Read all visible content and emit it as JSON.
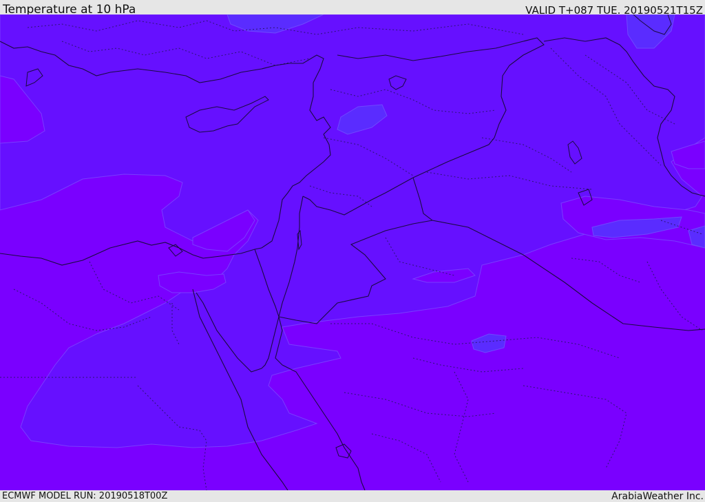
{
  "header": {
    "title": "Temperature at 10 hPa",
    "valid_time": "VALID T+087 TUE. 20190521T15Z"
  },
  "footer": {
    "model_run": "ECMWF MODEL RUN: 20190518T00Z",
    "credit": "ArabiaWeather Inc."
  },
  "map": {
    "field": "temperature",
    "level": "10 hPa",
    "colors": {
      "warm_field": "#7a00ff",
      "cool_field": "#6610ff",
      "coolest_field": "#5a2cff",
      "coast_border": "#1a0a40",
      "internal_border": "#2a1470"
    }
  }
}
